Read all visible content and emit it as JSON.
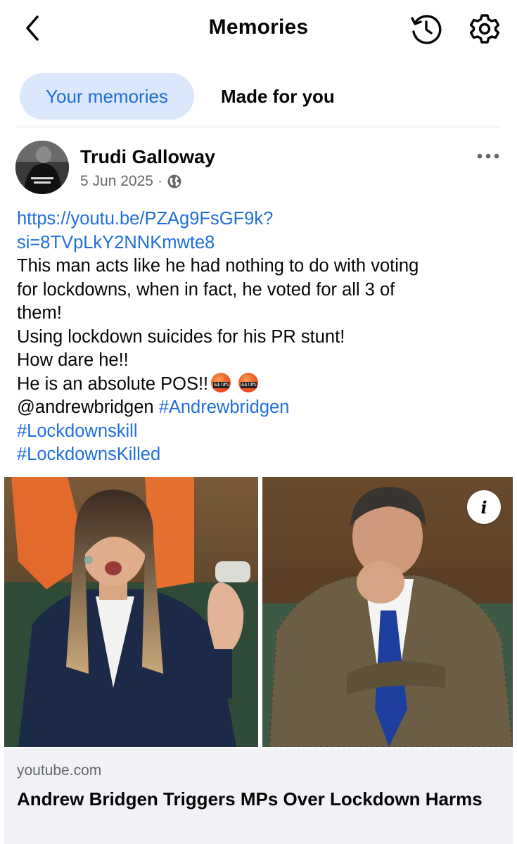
{
  "header": {
    "title": "Memories",
    "back_icon": "chevron-left-icon",
    "history_icon": "history-clock-icon",
    "settings_icon": "gear-icon"
  },
  "tabs": [
    {
      "label": "Your memories",
      "active": true
    },
    {
      "label": "Made for you",
      "active": false
    }
  ],
  "post": {
    "author": "Trudi Galloway",
    "date": "5 Jun 2025",
    "separator": "·",
    "audience_icon": "globe-icon",
    "more_icon": "more-dots-icon",
    "text_lines": [
      {
        "text": "https://youtu.be/PZAg9FsGF9k?",
        "link": true
      },
      {
        "text": "si=8TVpLkY2NNKmwte8",
        "link": true
      },
      {
        "text": "This man acts like he had nothing to do with voting",
        "link": false
      },
      {
        "text": "for lockdowns, when in fact, he voted for all 3 of",
        "link": false
      },
      {
        "text": "them!",
        "link": false
      },
      {
        "text": "Using lockdown suicides for his PR stunt!",
        "link": false
      },
      {
        "text": "How dare he!!",
        "link": false
      }
    ],
    "pos_line": "He is an absolute POS!!",
    "mention": "@andrewbridgen",
    "hashtag_1": "#Andrewbridgen",
    "hashtag_2": "#Lockdownskill",
    "hashtag_3": "#LockdownsKilled",
    "emoji_name": "face-with-symbols-on-mouth-emoji"
  },
  "link_preview": {
    "domain": "youtube.com",
    "title": "Andrew Bridgen Triggers MPs Over Lockdown Harms",
    "info_icon": "info-icon"
  },
  "colors": {
    "accent": "#1c6ddc",
    "link": "#216fdb",
    "active_tab_bg": "#dbe8fb",
    "secondary_text": "#65676b",
    "preview_bg": "#f0f2f5"
  }
}
